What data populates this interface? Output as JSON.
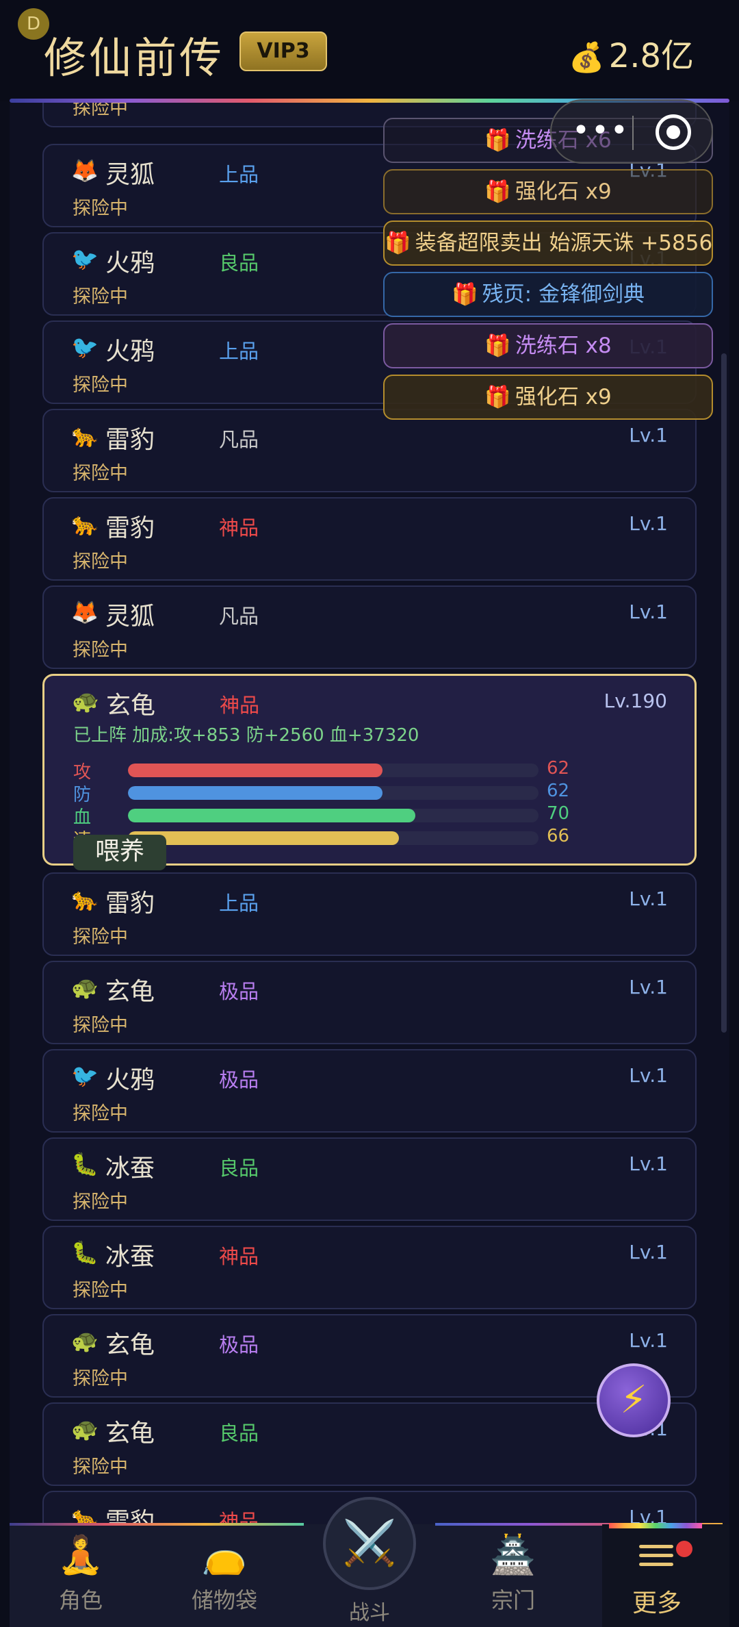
{
  "header": {
    "badge": "D",
    "title": "修仙前传",
    "vip": "VIP3",
    "money_icon": "money-bag-icon",
    "money": "2.8亿"
  },
  "pets": [
    {
      "icon": "",
      "name": "",
      "grade": "",
      "grade_class": "g-common",
      "status": "探险中",
      "level": ""
    },
    {
      "icon": "🦊",
      "name": "灵狐",
      "grade": "上品",
      "grade_class": "g-fine",
      "status": "探险中",
      "level": "Lv.1"
    },
    {
      "icon": "🐦",
      "name": "火鸦",
      "grade": "良品",
      "grade_class": "g-good",
      "status": "探险中",
      "level": "Lv.1"
    },
    {
      "icon": "🐦",
      "name": "火鸦",
      "grade": "上品",
      "grade_class": "g-fine",
      "status": "探险中",
      "level": "Lv.1"
    },
    {
      "icon": "🐆",
      "name": "雷豹",
      "grade": "凡品",
      "grade_class": "g-common",
      "status": "探险中",
      "level": "Lv.1"
    },
    {
      "icon": "🐆",
      "name": "雷豹",
      "grade": "神品",
      "grade_class": "g-divine",
      "status": "探险中",
      "level": "Lv.1"
    },
    {
      "icon": "🦊",
      "name": "灵狐",
      "grade": "凡品",
      "grade_class": "g-common",
      "status": "探险中",
      "level": "Lv.1"
    }
  ],
  "selected_pet": {
    "icon": "🐢",
    "name": "玄龟",
    "grade": "神品",
    "level": "Lv.190",
    "buff": "已上阵 加成:攻+853 防+2560 血+37320",
    "stats": [
      {
        "label": "攻",
        "value": "62",
        "pct": 62,
        "color": "#e05555"
      },
      {
        "label": "防",
        "value": "62",
        "pct": 62,
        "color": "#4f93e0"
      },
      {
        "label": "血",
        "value": "70",
        "pct": 70,
        "color": "#4fcf80"
      },
      {
        "label": "速",
        "value": "66",
        "pct": 66,
        "color": "#e2bf55"
      }
    ],
    "feed_label": "喂养"
  },
  "pets_after": [
    {
      "icon": "🐆",
      "name": "雷豹",
      "grade": "上品",
      "grade_class": "g-fine",
      "status": "探险中",
      "level": "Lv.1"
    },
    {
      "icon": "🐢",
      "name": "玄龟",
      "grade": "极品",
      "grade_class": "g-epic",
      "status": "探险中",
      "level": "Lv.1"
    },
    {
      "icon": "🐦",
      "name": "火鸦",
      "grade": "极品",
      "grade_class": "g-epic",
      "status": "探险中",
      "level": "Lv.1"
    },
    {
      "icon": "🐛",
      "name": "冰蚕",
      "grade": "良品",
      "grade_class": "g-good",
      "status": "探险中",
      "level": "Lv.1"
    },
    {
      "icon": "🐛",
      "name": "冰蚕",
      "grade": "神品",
      "grade_class": "g-divine",
      "status": "探险中",
      "level": "Lv.1"
    },
    {
      "icon": "🐢",
      "name": "玄龟",
      "grade": "极品",
      "grade_class": "g-epic",
      "status": "探险中",
      "level": "Lv.1"
    },
    {
      "icon": "🐢",
      "name": "玄龟",
      "grade": "良品",
      "grade_class": "g-good",
      "status": "探险中",
      "level": "Lv.1"
    },
    {
      "icon": "🐆",
      "name": "雷豹",
      "grade": "神品",
      "grade_class": "g-divine",
      "status": "",
      "level": "Lv.1"
    }
  ],
  "toasts": [
    {
      "text": "洗练石 x6",
      "style": "t-purple"
    },
    {
      "text": "强化石 x9",
      "style": "t-gold-dim"
    },
    {
      "text": "装备超限卖出 始源天诛 +5856",
      "style": "t-gold"
    },
    {
      "text": "残页: 金锋御剑典",
      "style": "t-blue"
    },
    {
      "text": "洗练石 x8",
      "style": "t-purple-solid"
    },
    {
      "text": "强化石 x9",
      "style": "t-gold"
    }
  ],
  "nav": [
    {
      "label": "角色",
      "icon": "meditating-figure-icon"
    },
    {
      "label": "储物袋",
      "icon": "storage-bag-icon"
    },
    {
      "label": "战斗",
      "icon": "crossed-swords-icon"
    },
    {
      "label": "宗门",
      "icon": "sect-temple-icon"
    },
    {
      "label": "更多",
      "icon": "menu-icon",
      "active": true
    }
  ],
  "fab_icon": "lightning-icon",
  "colors": {
    "gold": "#efd99f",
    "accent": "#e8c676",
    "bg": "#0b0d1a"
  }
}
